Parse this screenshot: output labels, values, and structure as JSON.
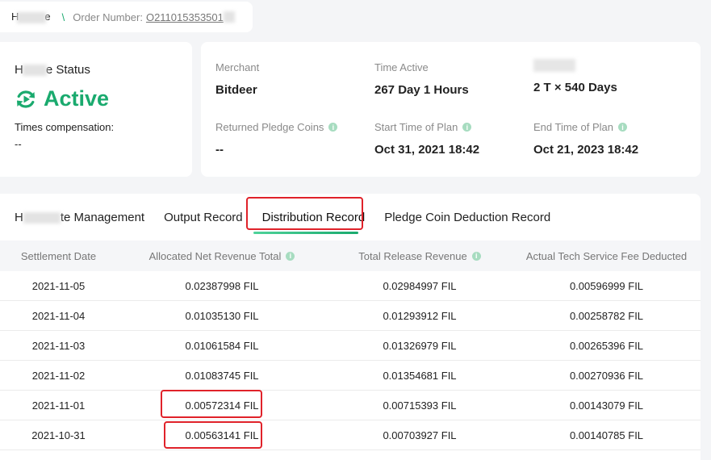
{
  "breadcrumb": {
    "first_prefix": "H",
    "first_suffix": "e",
    "order_label": "Order Number:",
    "order_number": "O211015353501"
  },
  "status_card": {
    "title_prefix": "H",
    "title_suffix": "e Status",
    "status": "Active",
    "comp_label": "Times compensation:",
    "comp_value": "--"
  },
  "info": {
    "merchant_label": "Merchant",
    "merchant_value": "Bitdeer",
    "time_active_label": "Time Active",
    "time_active_value": "267 Day 1 Hours",
    "capacity_value": "2 T × 540 Days",
    "returned_label": "Returned Pledge Coins",
    "returned_value": "--",
    "start_label": "Start Time of Plan",
    "start_value": "Oct 31, 2021 18:42",
    "end_label": "End Time of Plan",
    "end_value": "Oct 21, 2023 18:42"
  },
  "tabs": {
    "management_prefix": "H",
    "management_suffix": "te Management",
    "output": "Output Record",
    "distribution": "Distribution Record",
    "pledge": "Pledge Coin Deduction Record"
  },
  "table": {
    "headers": {
      "date": "Settlement Date",
      "net": "Allocated Net Revenue Total",
      "release": "Total Release Revenue",
      "fee": "Actual Tech Service Fee Deducted"
    },
    "rows": [
      {
        "date": "2021-11-05",
        "net": "0.02387998 FIL",
        "release": "0.02984997 FIL",
        "fee": "0.00596999 FIL"
      },
      {
        "date": "2021-11-04",
        "net": "0.01035130 FIL",
        "release": "0.01293912 FIL",
        "fee": "0.00258782 FIL"
      },
      {
        "date": "2021-11-03",
        "net": "0.01061584 FIL",
        "release": "0.01326979 FIL",
        "fee": "0.00265396 FIL"
      },
      {
        "date": "2021-11-02",
        "net": "0.01083745 FIL",
        "release": "0.01354681 FIL",
        "fee": "0.00270936 FIL"
      },
      {
        "date": "2021-11-01",
        "net": "0.00572314 FIL",
        "release": "0.00715393 FIL",
        "fee": "0.00143079 FIL"
      },
      {
        "date": "2021-10-31",
        "net": "0.00563141 FIL",
        "release": "0.00703927 FIL",
        "fee": "0.00140785 FIL"
      }
    ]
  },
  "colors": {
    "accent": "#1aaa6e",
    "annotation": "#e0222a"
  }
}
